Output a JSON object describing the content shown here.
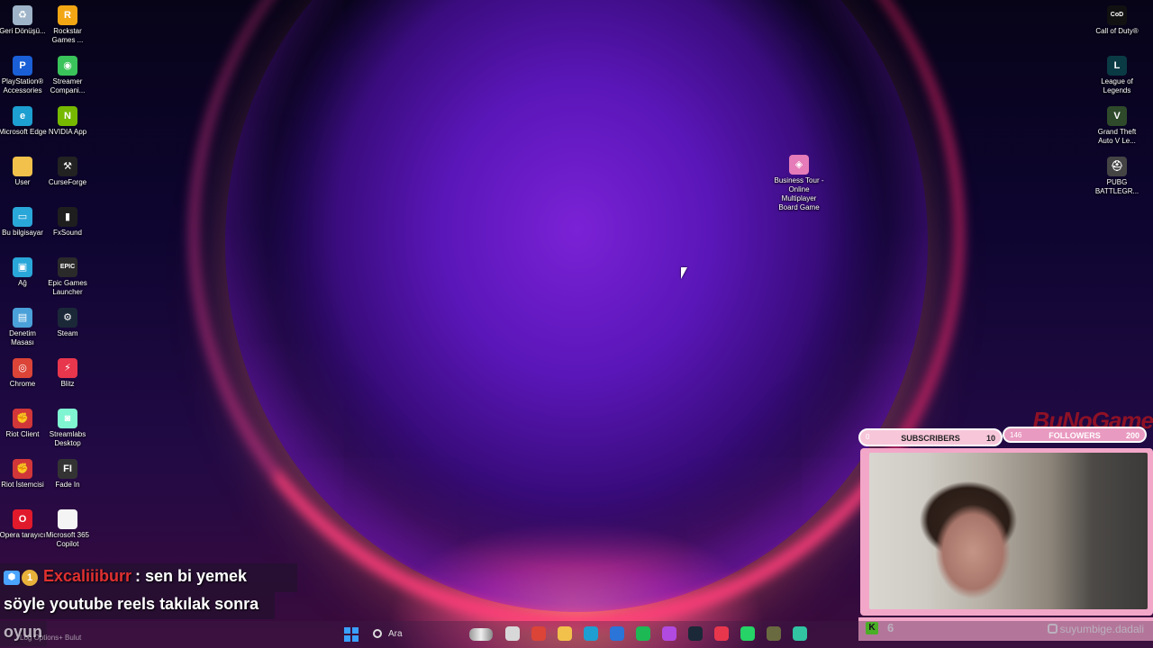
{
  "desktop": {
    "left_icons": [
      {
        "label": "Geri Dönüşü...",
        "icon": "recycle-bin-icon",
        "color": "#9fb4c8",
        "glyph": "♻"
      },
      {
        "label": "Rockstar Games ...",
        "icon": "rockstar-games-icon",
        "color": "#f3a614",
        "glyph": "R"
      },
      {
        "label": "PlayStation® Accessories",
        "icon": "playstation-accessories-icon",
        "color": "#1a5fd6",
        "glyph": "P"
      },
      {
        "label": "Streamer Compani...",
        "icon": "streamer-companion-icon",
        "color": "#3ac35a",
        "glyph": "◉"
      },
      {
        "label": "Microsoft Edge",
        "icon": "edge-icon",
        "color": "#1d9fd1",
        "glyph": "e"
      },
      {
        "label": "NVIDIA App",
        "icon": "nvidia-app-icon",
        "color": "#76b900",
        "glyph": "N"
      },
      {
        "label": "User",
        "icon": "folder-icon",
        "color": "#f2c14b",
        "glyph": ""
      },
      {
        "label": "CurseForge",
        "icon": "curseforge-icon",
        "color": "#222222",
        "glyph": "⚒"
      },
      {
        "label": "Bu bilgisayar",
        "icon": "this-pc-icon",
        "color": "#2aa7d9",
        "glyph": "▭"
      },
      {
        "label": "FxSound",
        "icon": "fxsound-icon",
        "color": "#1e1e1e",
        "glyph": "▮"
      },
      {
        "label": "Ağ",
        "icon": "network-icon",
        "color": "#2aa7d9",
        "glyph": "▣"
      },
      {
        "label": "Epic Games Launcher",
        "icon": "epic-games-icon",
        "color": "#2a2a2a",
        "glyph": "EPIC"
      },
      {
        "label": "Denetim Masası",
        "icon": "control-panel-icon",
        "color": "#4aa0d8",
        "glyph": "▤"
      },
      {
        "label": "Steam",
        "icon": "steam-icon",
        "color": "#1b2838",
        "glyph": "⚙"
      },
      {
        "label": "Chrome",
        "icon": "chrome-icon",
        "color": "#db4437",
        "glyph": "◎"
      },
      {
        "label": "Blitz",
        "icon": "blitz-icon",
        "color": "#e8364d",
        "glyph": "⚡"
      },
      {
        "label": "Riot Client",
        "icon": "riot-client-icon",
        "color": "#d13639",
        "glyph": "✊"
      },
      {
        "label": "Streamlabs Desktop",
        "icon": "streamlabs-icon",
        "color": "#80f5d2",
        "glyph": "◙"
      },
      {
        "label": "Riot İstemcisi",
        "icon": "riot-client-tr-icon",
        "color": "#d13639",
        "glyph": "✊"
      },
      {
        "label": "Fade In",
        "icon": "fade-in-icon",
        "color": "#333333",
        "glyph": "FI"
      },
      {
        "label": "Opera tarayıcı",
        "icon": "opera-icon",
        "color": "#e01a2b",
        "glyph": "O"
      },
      {
        "label": "Microsoft 365 Copilot",
        "icon": "document-icon",
        "color": "#f4f4f4",
        "glyph": ""
      }
    ],
    "right_icons": [
      {
        "label": "Call of Duty®",
        "icon": "call-of-duty-icon",
        "color": "#111111",
        "glyph": "CoD"
      },
      {
        "label": "League of Legends",
        "icon": "league-of-legends-icon",
        "color": "#0a3a44",
        "glyph": "L"
      },
      {
        "label": "Grand Theft Auto V Le...",
        "icon": "gta-v-icon",
        "color": "#2e4a2a",
        "glyph": "V"
      },
      {
        "label": "PUBG BATTLEGR...",
        "icon": "pubg-icon",
        "color": "#444444",
        "glyph": "⛑"
      }
    ],
    "center_icon": {
      "label": "Business Tour - Online Multiplayer Board Game",
      "icon": "business-tour-icon",
      "color": "#e57bb8",
      "glyph": "◈"
    }
  },
  "overlay": {
    "logo_text": "BuNoGame",
    "subscribers": {
      "label": "SUBSCRIBERS",
      "start": "0",
      "goal": "10",
      "progress": 0.0
    },
    "followers": {
      "label": "FOLLOWERS",
      "start": "146",
      "goal": "200"
    },
    "kick_viewers": "6",
    "instagram_handle": "suyumbige.dadali"
  },
  "chat": {
    "username": "Excaliiiburr",
    "message": ": sen bi yemek",
    "line2": "söyle youtube reels takılak sonra",
    "line3": "oyun"
  },
  "taskbar": {
    "hint_text": "Log Options+  Bulut",
    "search_placeholder": "Ara",
    "apps": [
      {
        "name": "taskview-icon",
        "color": "#d8d8d8"
      },
      {
        "name": "chrome-taskbar-icon",
        "color": "#db4437"
      },
      {
        "name": "file-explorer-icon",
        "color": "#f2c14b"
      },
      {
        "name": "edge-taskbar-icon",
        "color": "#1d9fd1"
      },
      {
        "name": "store-icon",
        "color": "#2b74d8"
      },
      {
        "name": "spotify-icon",
        "color": "#1db954"
      },
      {
        "name": "copilot-icon",
        "color": "#b04ae0"
      },
      {
        "name": "steam-taskbar-icon",
        "color": "#1b2838"
      },
      {
        "name": "blitz-taskbar-icon",
        "color": "#e8364d"
      },
      {
        "name": "whatsapp-icon",
        "color": "#25d366"
      },
      {
        "name": "nvidia-taskbar-icon",
        "color": "#6a6a40"
      },
      {
        "name": "streamlabs-taskbar-icon",
        "color": "#31c3a2"
      }
    ]
  }
}
